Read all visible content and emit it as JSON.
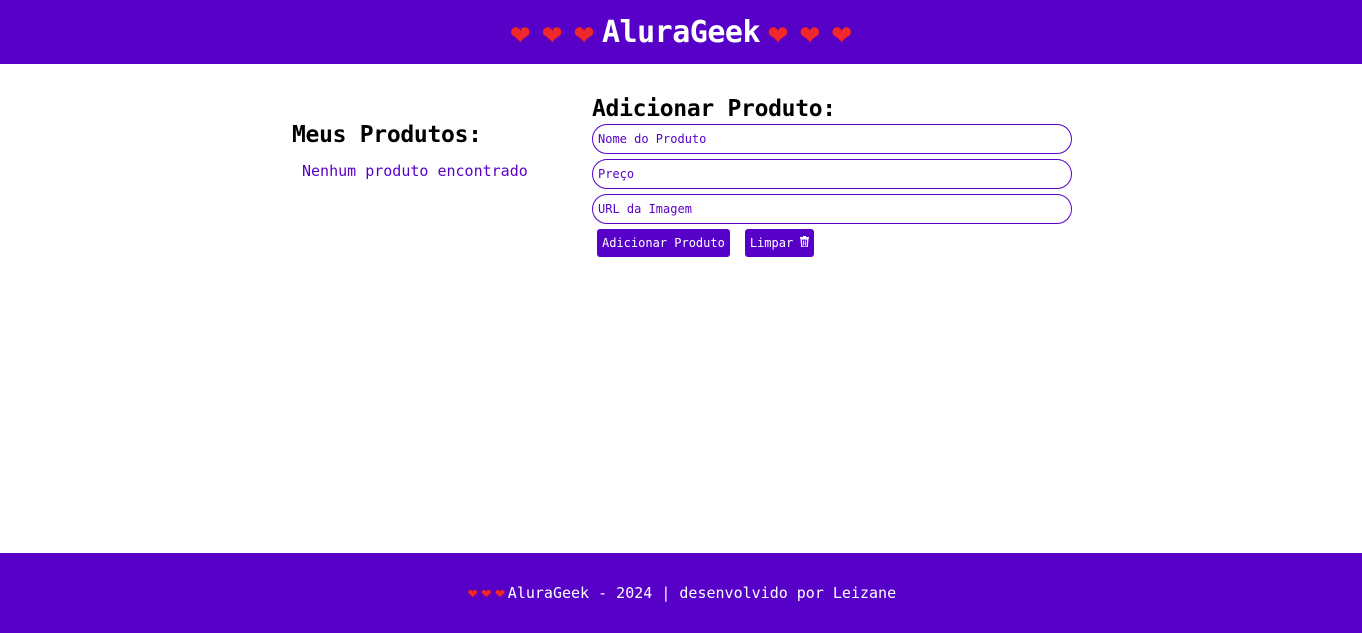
{
  "header": {
    "brand": "AluraGeek",
    "heart_glyph": "❤",
    "heart_color": "#f0272c",
    "background": "#5600c8"
  },
  "products": {
    "title": "Meus Produtos:",
    "empty_message": "Nenhum produto encontrado"
  },
  "form": {
    "title": "Adicionar Produto:",
    "name_placeholder": "Nome do Produto",
    "price_placeholder": "Preço",
    "image_placeholder": "URL da Imagem",
    "submit_label": "Adicionar Produto",
    "clear_label": "Limpar",
    "clear_icon": "trash-icon"
  },
  "footer": {
    "text": "AluraGeek - 2024 | desenvolvido por Leizane"
  }
}
